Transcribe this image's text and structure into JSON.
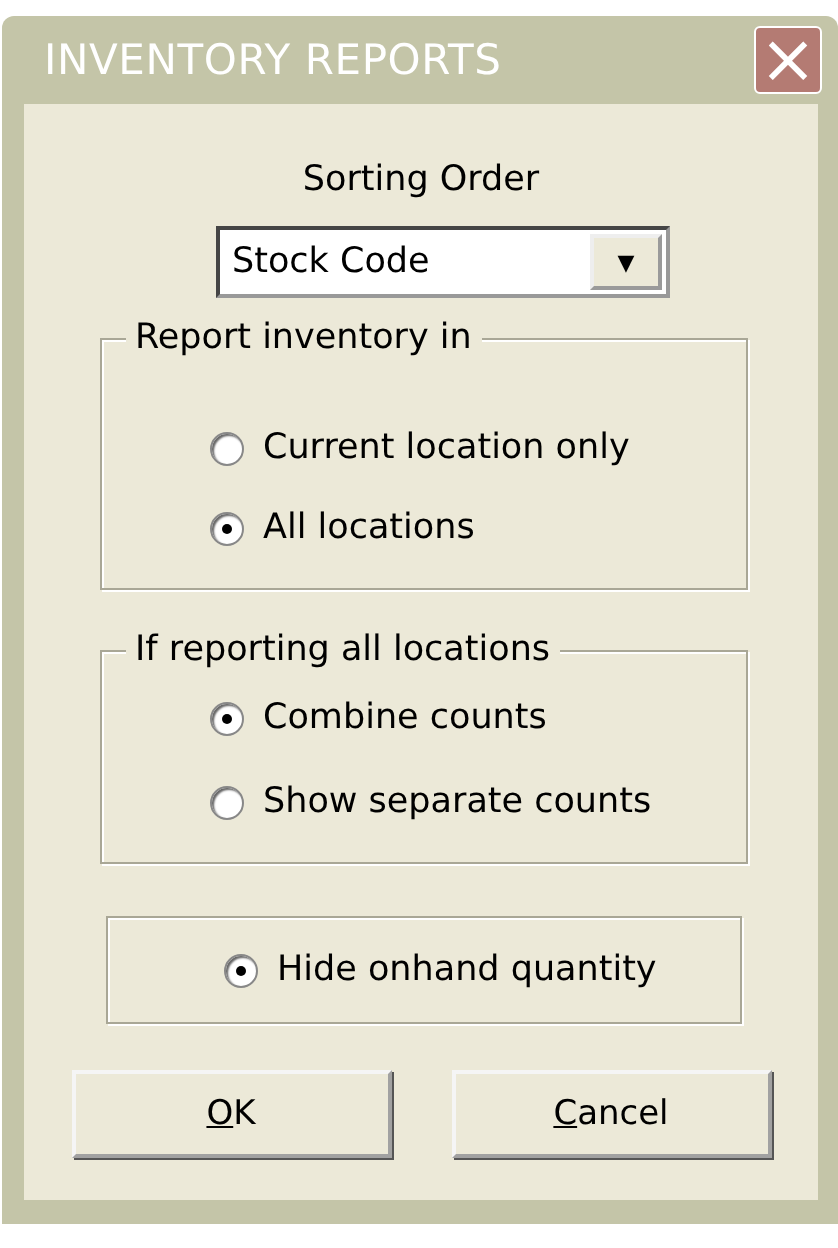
{
  "window": {
    "title": "INVENTORY REPORTS",
    "close": "×"
  },
  "sorting": {
    "label": "Sorting Order",
    "value": "Stock Code",
    "arrow": "▼"
  },
  "groups": [
    {
      "legend": "Report inventory in",
      "options": [
        {
          "label": "Current location only",
          "selected": false
        },
        {
          "label": "All locations",
          "selected": true
        }
      ]
    },
    {
      "legend": "If reporting all locations",
      "options": [
        {
          "label": "Combine counts",
          "selected": true
        },
        {
          "label": "Show separate counts",
          "selected": false
        }
      ]
    },
    {
      "options": [
        {
          "label": "Hide onhand quantity",
          "selected": true
        }
      ]
    }
  ],
  "buttons": [
    {
      "label": "OK",
      "mnemonic_first": true
    },
    {
      "label": "Cancel",
      "mnemonic_first": true
    }
  ]
}
